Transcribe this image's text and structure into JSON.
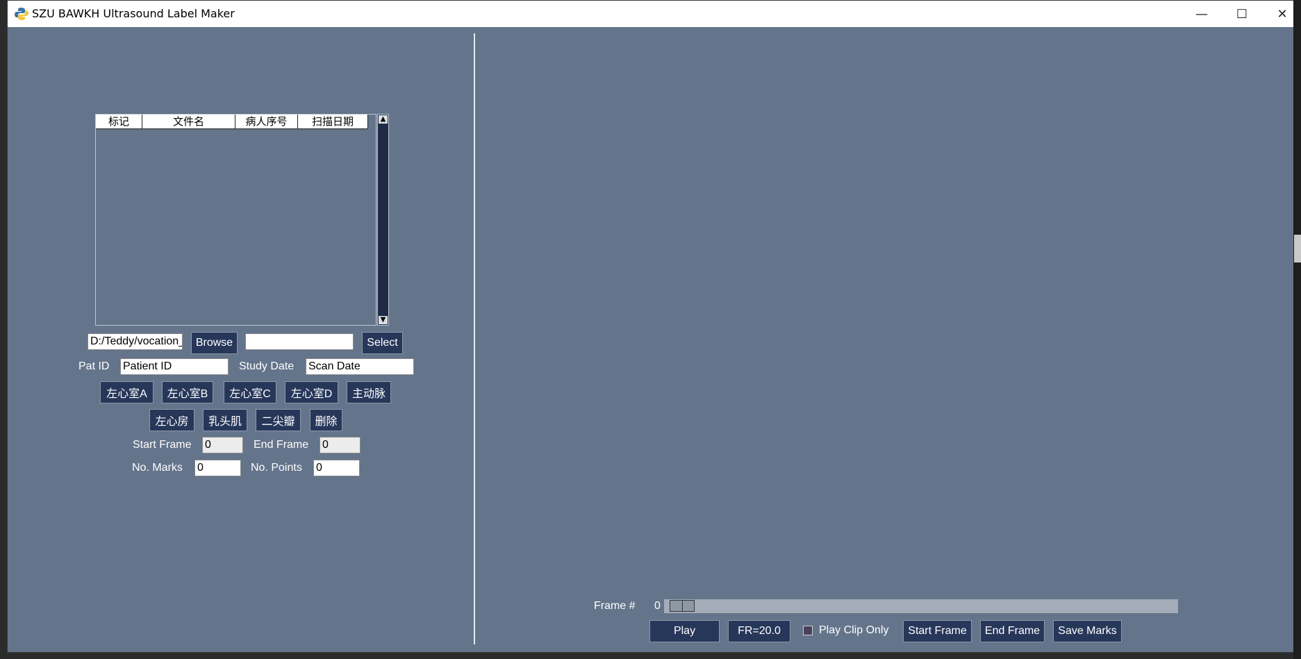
{
  "window": {
    "title": "SZU BAWKH Ultrasound Label Maker",
    "controls": {
      "minimize": "—",
      "maximize": "☐",
      "close": "✕"
    }
  },
  "file_table": {
    "columns": [
      "标记",
      "文件名",
      "病人序号",
      "扫描日期"
    ],
    "rows": []
  },
  "path_row": {
    "path_value": "D:/Teddy/vocation_",
    "browse_label": "Browse",
    "select_value": "",
    "select_label": "Select"
  },
  "info_row": {
    "pat_id_label": "Pat ID",
    "pat_id_value": "Patient ID",
    "study_date_label": "Study Date",
    "study_date_value": "Scan Date"
  },
  "label_buttons": {
    "row1": [
      "左心室A",
      "左心室B",
      "左心室C",
      "左心室D",
      "主动脉"
    ],
    "row2": [
      "左心房",
      "乳头肌",
      "二尖瓣",
      "删除"
    ]
  },
  "frames": {
    "start_label": "Start Frame",
    "start_value": "0",
    "end_label": "End Frame",
    "end_value": "0",
    "marks_label": "No. Marks",
    "marks_value": "0",
    "points_label": "No. Points",
    "points_value": "0"
  },
  "player": {
    "frame_label": "Frame #",
    "frame_value": "0",
    "slider_value": 0,
    "play_label": "Play",
    "fr_label": "FR=20.0",
    "play_clip_only_label": "Play Clip Only",
    "play_clip_only_checked": false,
    "start_frame_label": "Start Frame",
    "end_frame_label": "End Frame",
    "save_marks_label": "Save Marks"
  },
  "colors": {
    "background": "#64748b",
    "button": "#27375a",
    "scrollbar": "#1f2b45"
  }
}
